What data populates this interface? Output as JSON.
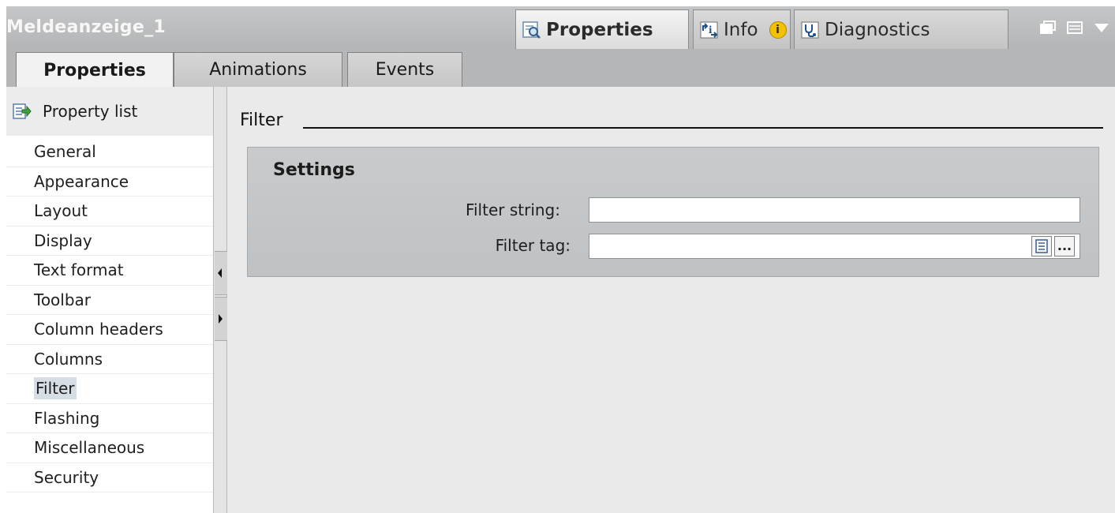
{
  "window": {
    "title": "Meldeanzeige_1",
    "tabs": [
      {
        "label": "Properties",
        "icon": "properties-magnifier-icon",
        "active": true
      },
      {
        "label": "Info",
        "icon": "info-arrow-icon",
        "badge": "i"
      },
      {
        "label": "Diagnostics",
        "icon": "diagnostics-stethoscope-icon"
      }
    ]
  },
  "sub_tabs": [
    {
      "label": "Properties",
      "active": true
    },
    {
      "label": "Animations"
    },
    {
      "label": "Events"
    }
  ],
  "sidebar": {
    "header": "Property list",
    "items": [
      {
        "label": "General"
      },
      {
        "label": "Appearance"
      },
      {
        "label": "Layout"
      },
      {
        "label": "Display"
      },
      {
        "label": "Text format"
      },
      {
        "label": "Toolbar"
      },
      {
        "label": "Column headers"
      },
      {
        "label": "Columns"
      },
      {
        "label": "Filter",
        "selected": true
      },
      {
        "label": "Flashing"
      },
      {
        "label": "Miscellaneous"
      },
      {
        "label": "Security"
      }
    ]
  },
  "main": {
    "title": "Filter",
    "settings": {
      "title": "Settings",
      "filter_string_label": "Filter string:",
      "filter_string_value": "",
      "filter_tag_label": "Filter tag:",
      "filter_tag_value": "",
      "browse_label": "..."
    }
  },
  "colors": {
    "title_bar": "#b8babb",
    "content_bg": "#eaeaea",
    "selected_item": "#d7dde4"
  }
}
